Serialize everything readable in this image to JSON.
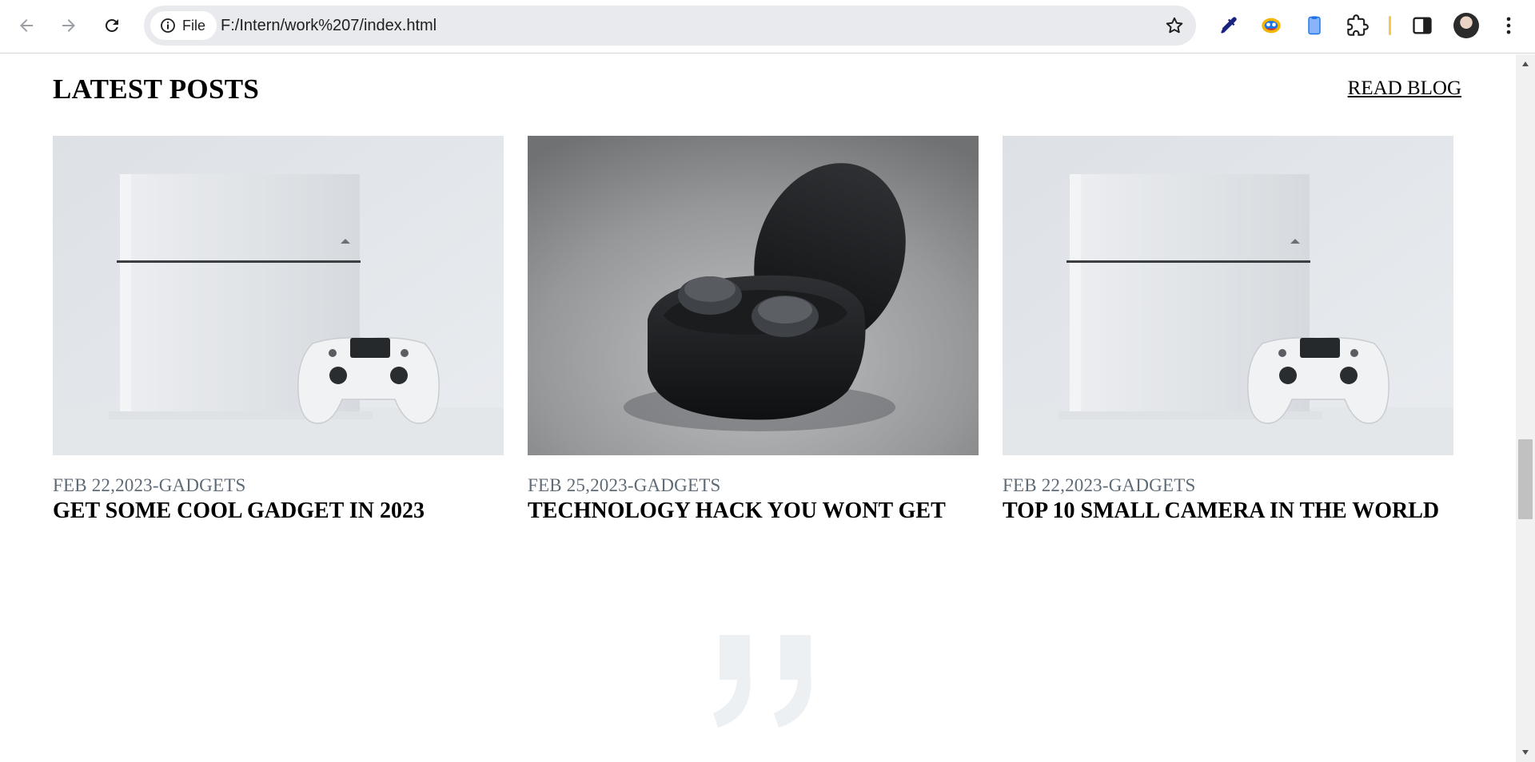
{
  "browser": {
    "back_icon": "arrow-left-icon",
    "forward_icon": "arrow-right-icon",
    "reload_icon": "reload-icon",
    "site_chip_label": "File",
    "url": "F:/Intern/work%207/index.html",
    "bookmark_icon": "star-icon",
    "toolbar_icons": [
      "eyedropper-icon",
      "extension-colorful-icon",
      "clipboard-icon",
      "puzzle-icon",
      "side-panel-icon",
      "avatar",
      "kebab-menu-icon"
    ]
  },
  "section": {
    "title": "LATEST POSTS",
    "read_link": "READ BLOG"
  },
  "posts": [
    {
      "meta": "FEB 22,2023-GADGETS",
      "title": "GET SOME COOL GADGET IN 2023",
      "image": "console-and-controller-photo"
    },
    {
      "meta": "FEB 25,2023-GADGETS",
      "title": "TECHNOLOGY HACK YOU WONT GET",
      "image": "wireless-earbuds-photo"
    },
    {
      "meta": "FEB 22,2023-GADGETS",
      "title": "TOP 10 SMALL CAMERA IN THE WORLD",
      "image": "console-and-controller-photo"
    }
  ],
  "decorations": {
    "quote_icon": "quote-mark-icon",
    "quote_color": "#edf0f3"
  },
  "colors": {
    "meta_text": "#5f6b77",
    "omnibox_bg": "#e8eaed"
  }
}
